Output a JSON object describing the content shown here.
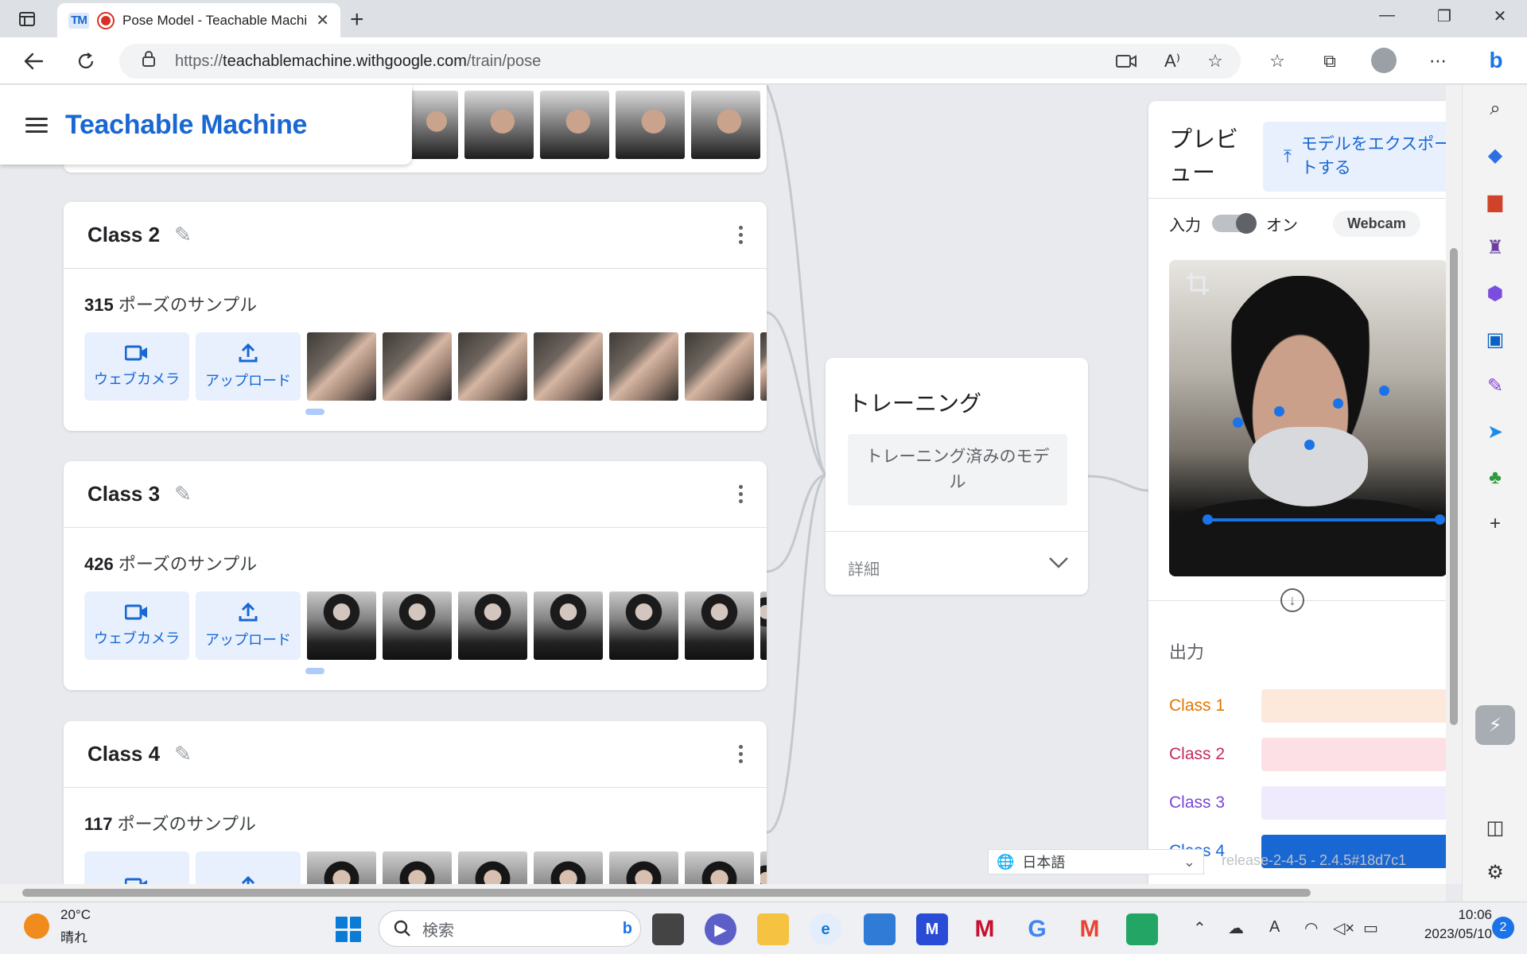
{
  "browser": {
    "tab_title": "Pose Model - Teachable Machine",
    "tm_favicon": "TM",
    "url_prefix": "https://",
    "url_host": "teachablemachine.withgoogle.com",
    "url_path": "/train/pose"
  },
  "app": {
    "logo": "Teachable Machine"
  },
  "classes": [
    {
      "name": "Class 2",
      "count": "315",
      "count_label": "ポーズのサンプル"
    },
    {
      "name": "Class 3",
      "count": "426",
      "count_label": "ポーズのサンプル"
    },
    {
      "name": "Class 4",
      "count": "117",
      "count_label": "ポーズのサンプル"
    }
  ],
  "buttons": {
    "webcam": "ウェブカメラ",
    "upload": "アップロード"
  },
  "training": {
    "title": "トレーニング",
    "button": "トレーニング済みのモデル",
    "detail": "詳細"
  },
  "preview": {
    "title": "プレビュー",
    "export": "モデルをエクスポートする",
    "input_label": "入力",
    "input_state": "オン",
    "input_source": "Webcam",
    "output_title": "出力",
    "outputs": [
      {
        "label": "Class 1",
        "color": "#e37400",
        "bar": "#fde8dc",
        "value": 0
      },
      {
        "label": "Class 2",
        "color": "#c5295f",
        "bar": "#fde0e6",
        "value": 0
      },
      {
        "label": "Class 3",
        "color": "#7b45d9",
        "bar": "#efeafc",
        "value": 0
      },
      {
        "label": "Class 4",
        "color": "#1967d2",
        "bar": "#1967d2",
        "value": 1
      }
    ]
  },
  "footer": {
    "language": "日本語",
    "release": "release-2-4-5 - 2.4.5#18d7c1"
  },
  "taskbar": {
    "temp": "20°C",
    "condition": "晴れ",
    "search_placeholder": "検索",
    "time": "10:06",
    "date": "2023/05/10",
    "notifications": "2"
  }
}
